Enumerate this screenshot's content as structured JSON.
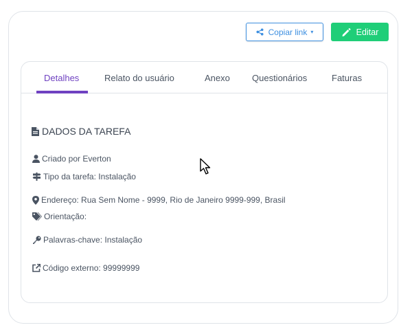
{
  "toolbar": {
    "share_label": "Copiar link",
    "share_caret": "▾",
    "edit_label": "Editar"
  },
  "tabs": [
    {
      "label": "Detalhes",
      "active": true
    },
    {
      "label": "Relato do usuário",
      "active": false
    },
    {
      "label": "Anexo",
      "active": false
    },
    {
      "label": "Questionários",
      "active": false
    },
    {
      "label": "Faturas",
      "active": false
    }
  ],
  "details": {
    "title": "DADOS DA TAREFA",
    "created_by": "Criado por Everton",
    "task_type": "Tipo da tarefa: Instalação",
    "address": "Endereço: Rua Sem Nome - 9999, Rio de Janeiro 9999-999, Brasil",
    "orientation": "Orientação:",
    "keywords": "Palavras-chave: Instalação",
    "external_code": "Código externo: 99999999"
  },
  "colors": {
    "accent_purple": "#6f42c1",
    "share_blue": "#3d8fe0",
    "edit_green": "#1fce78"
  },
  "icons": {
    "share": "share-icon",
    "edit": "pencil-icon",
    "title": "file-icon",
    "created_by": "user-icon",
    "task_type": "signpost-icon",
    "address": "map-marker-icon",
    "orientation": "tags-icon",
    "keywords": "key-icon",
    "external_code": "external-link-icon",
    "cursor": "mouse-pointer-icon"
  }
}
